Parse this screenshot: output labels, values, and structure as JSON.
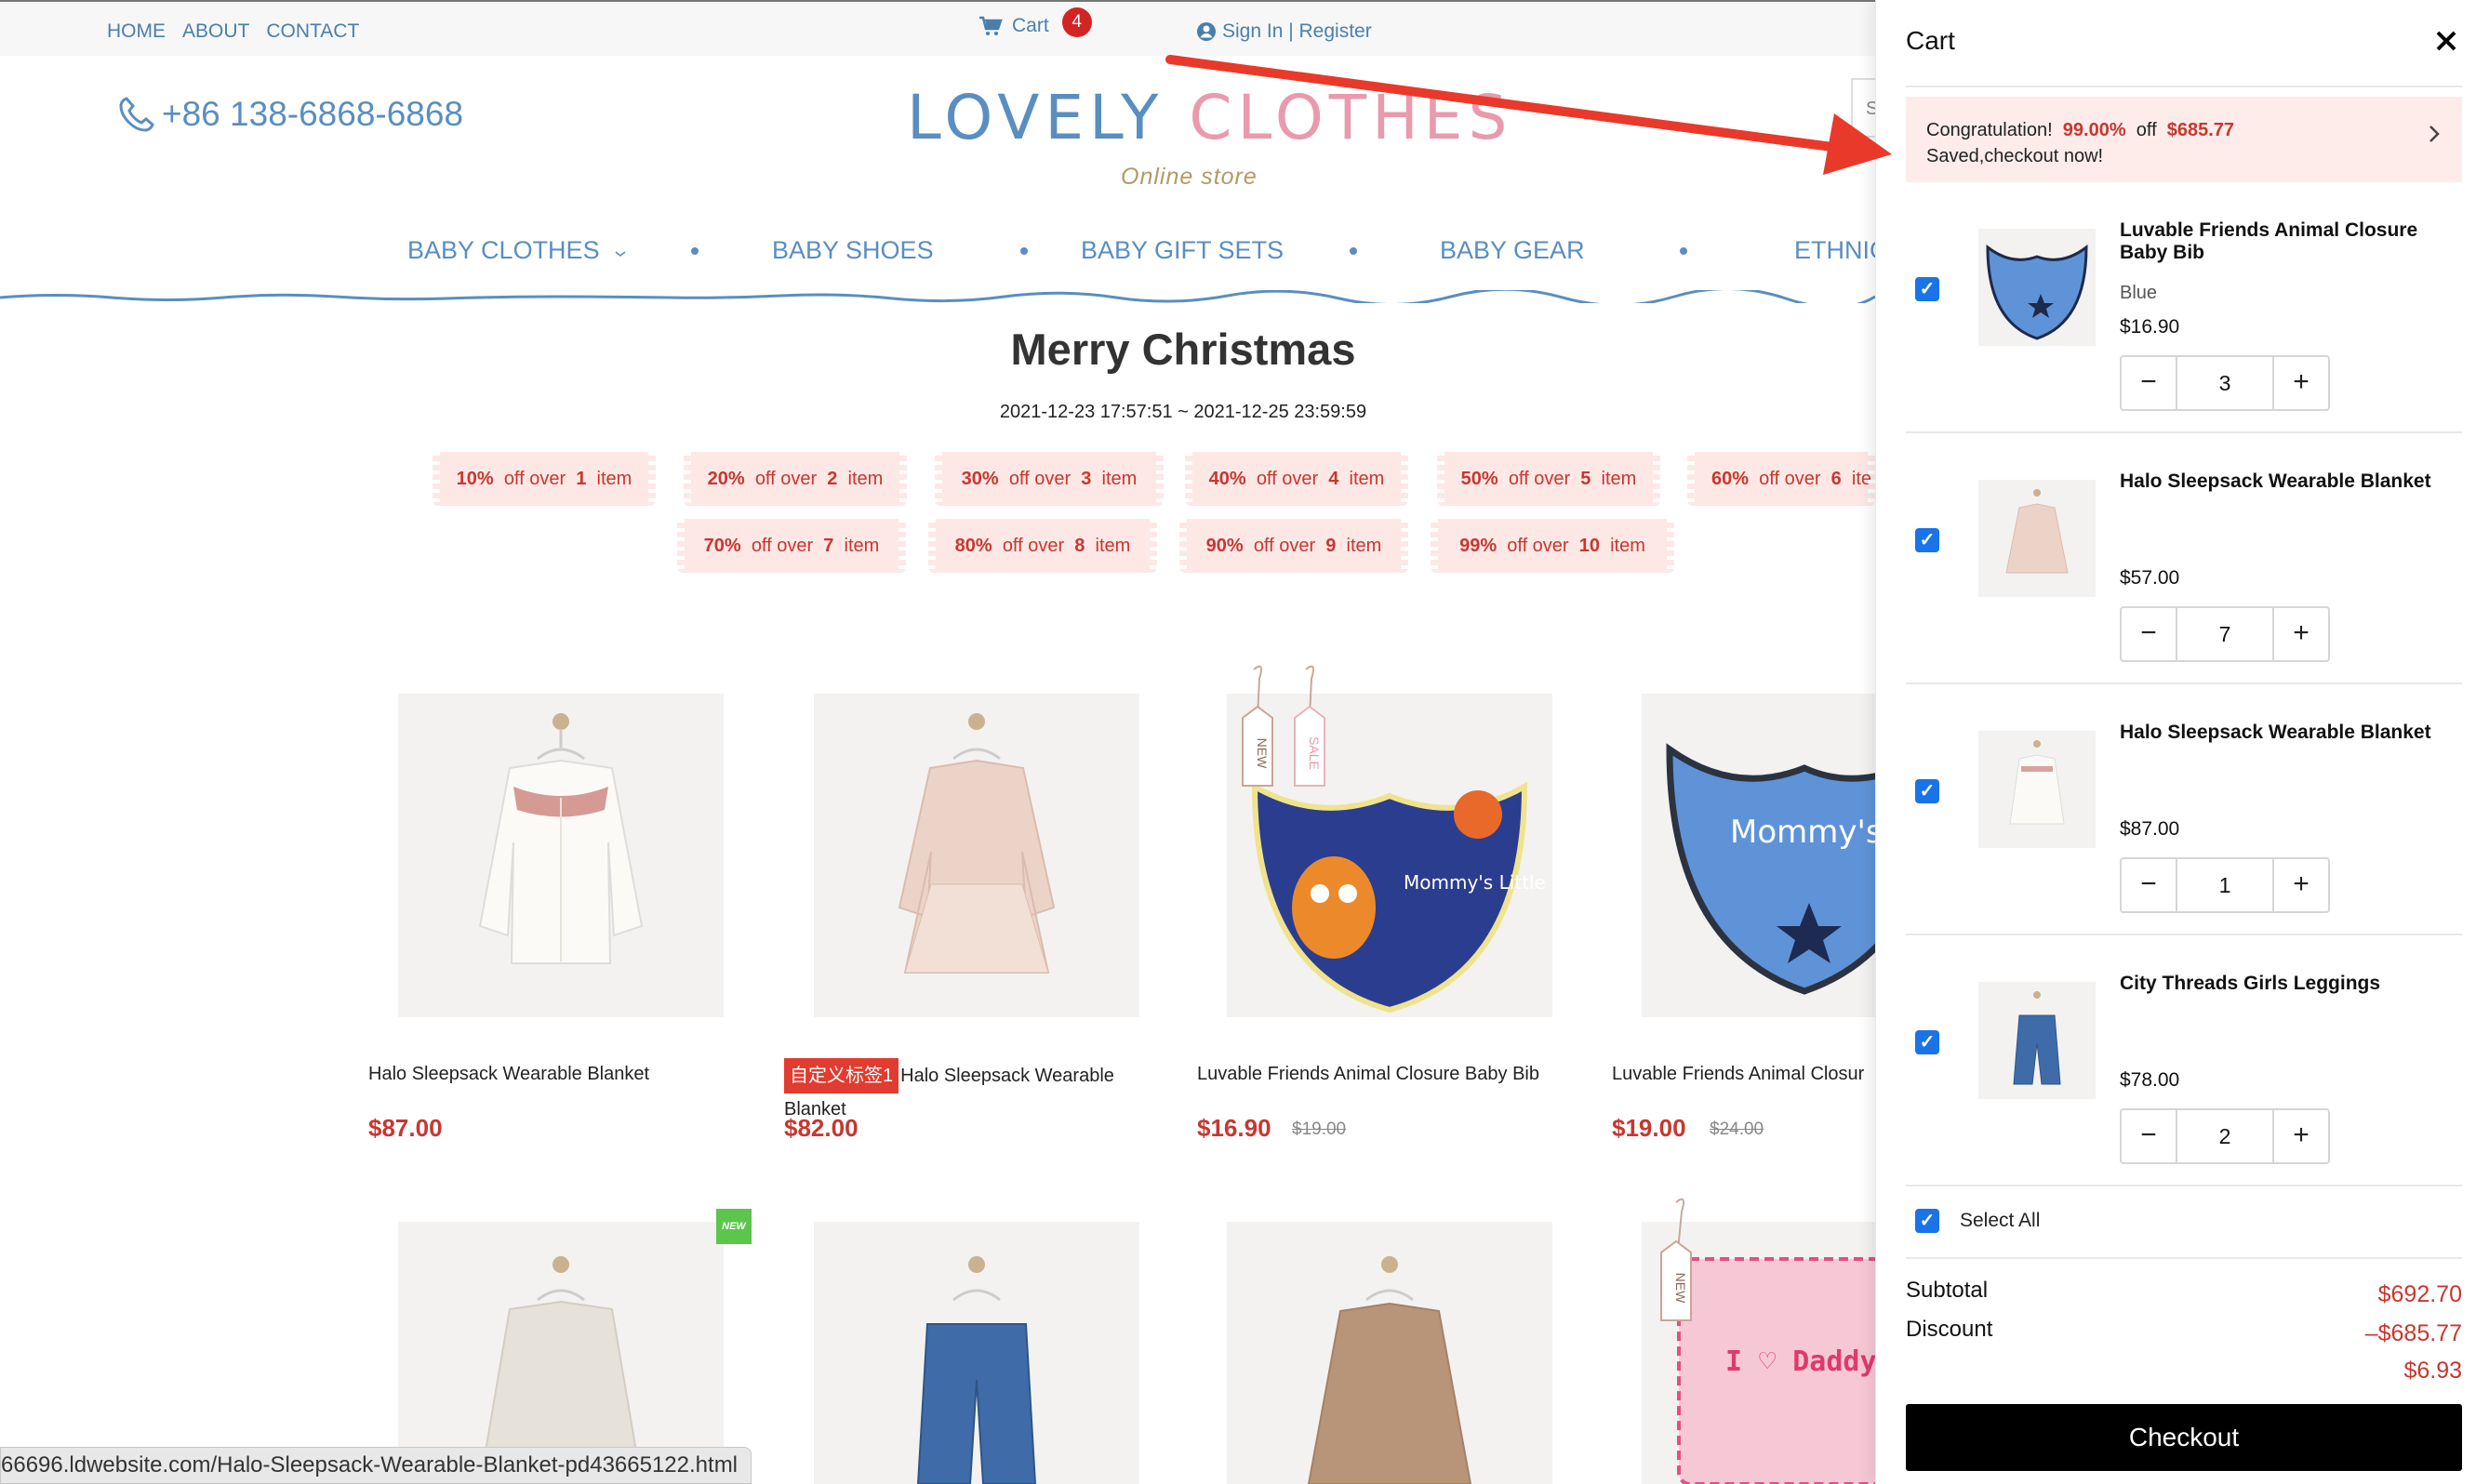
{
  "topbar": {
    "nav": [
      "HOME",
      "ABOUT",
      "CONTACT"
    ],
    "cart_label": "Cart",
    "cart_count": "4",
    "signin": "Sign In | Register"
  },
  "header": {
    "phone": "+86 138-6868-6868",
    "brand_part1": "LOVELY ",
    "brand_part2": "CLOTHES",
    "tagline": "Online store",
    "search_stub": "S"
  },
  "categories": [
    "BABY CLOTHES",
    "BABY SHOES",
    "BABY GIFT SETS",
    "BABY GEAR",
    "ETHNIC"
  ],
  "promotion": {
    "title": "Merry Christmas",
    "range": "2021-12-23 17:57:51 ~ 2021-12-25 23:59:59",
    "tiers": [
      {
        "pct": "10%",
        "text": "off over",
        "n": "1",
        "unit": "item"
      },
      {
        "pct": "20%",
        "text": "off over",
        "n": "2",
        "unit": "item"
      },
      {
        "pct": "30%",
        "text": "off over",
        "n": "3",
        "unit": "item"
      },
      {
        "pct": "40%",
        "text": "off over",
        "n": "4",
        "unit": "item"
      },
      {
        "pct": "50%",
        "text": "off over",
        "n": "5",
        "unit": "item"
      },
      {
        "pct": "60%",
        "text": "off over",
        "n": "6",
        "unit": "ite"
      },
      {
        "pct": "70%",
        "text": "off over",
        "n": "7",
        "unit": "item"
      },
      {
        "pct": "80%",
        "text": "off over",
        "n": "8",
        "unit": "item"
      },
      {
        "pct": "90%",
        "text": "off over",
        "n": "9",
        "unit": "item"
      },
      {
        "pct": "99%",
        "text": "off over",
        "n": "10",
        "unit": "item"
      }
    ]
  },
  "products": [
    {
      "name": "Halo Sleepsack Wearable Blanket",
      "price": "$87.00",
      "old": ""
    },
    {
      "tag": "自定义标签1",
      "name": "Halo Sleepsack Wearable Blanket",
      "price": "$82.00",
      "old": ""
    },
    {
      "name": "Luvable Friends Animal Closure Baby Bib",
      "price": "$16.90",
      "old": "$19.00"
    },
    {
      "name": "Luvable Friends Animal Closur",
      "price": "$19.00",
      "old": "$24.00"
    }
  ],
  "product_art": {
    "bib_text": "Mommy's Little Monster",
    "bib2_text": "Mommy's Little Boy",
    "hang_tag_new": "NEW",
    "hang_tag_sale": "SALE",
    "new_badge": "NEW",
    "daddy_text": "I ♡ Daddy"
  },
  "status_url": "66696.ldwebsite.com/Halo-Sleepsack-Wearable-Blanket-pd43665122.html",
  "cart": {
    "title": "Cart",
    "congrats_line1_a": "Congratulation!",
    "congrats_pct": "99.00%",
    "congrats_off": "off",
    "congrats_amount": "$685.77",
    "congrats_line2": "Saved,checkout now!",
    "items": [
      {
        "title": "Luvable Friends Animal Closure Baby Bib",
        "variant": "Blue",
        "price": "$16.90",
        "qty": "3"
      },
      {
        "title": "Halo Sleepsack Wearable Blanket",
        "variant": "",
        "price": "$57.00",
        "qty": "7"
      },
      {
        "title": "Halo Sleepsack Wearable Blanket",
        "variant": "",
        "price": "$87.00",
        "qty": "1"
      },
      {
        "title": "City Threads Girls Leggings",
        "variant": "",
        "price": "$78.00",
        "qty": "2"
      }
    ],
    "select_all": "Select All",
    "subtotal_label": "Subtotal",
    "subtotal": "$692.70",
    "discount_label": "Discount",
    "discount": "–$685.77",
    "total": "$6.93",
    "checkout": "Checkout",
    "check_mark": "✓",
    "minus": "−",
    "plus": "+"
  },
  "colors": {
    "brand_blue": "#5a8ec0",
    "brand_pink": "#e99aac",
    "promo_red": "#c7372f",
    "checkbox_blue": "#1a73e8",
    "annotation_arrow": "#e8392b"
  }
}
